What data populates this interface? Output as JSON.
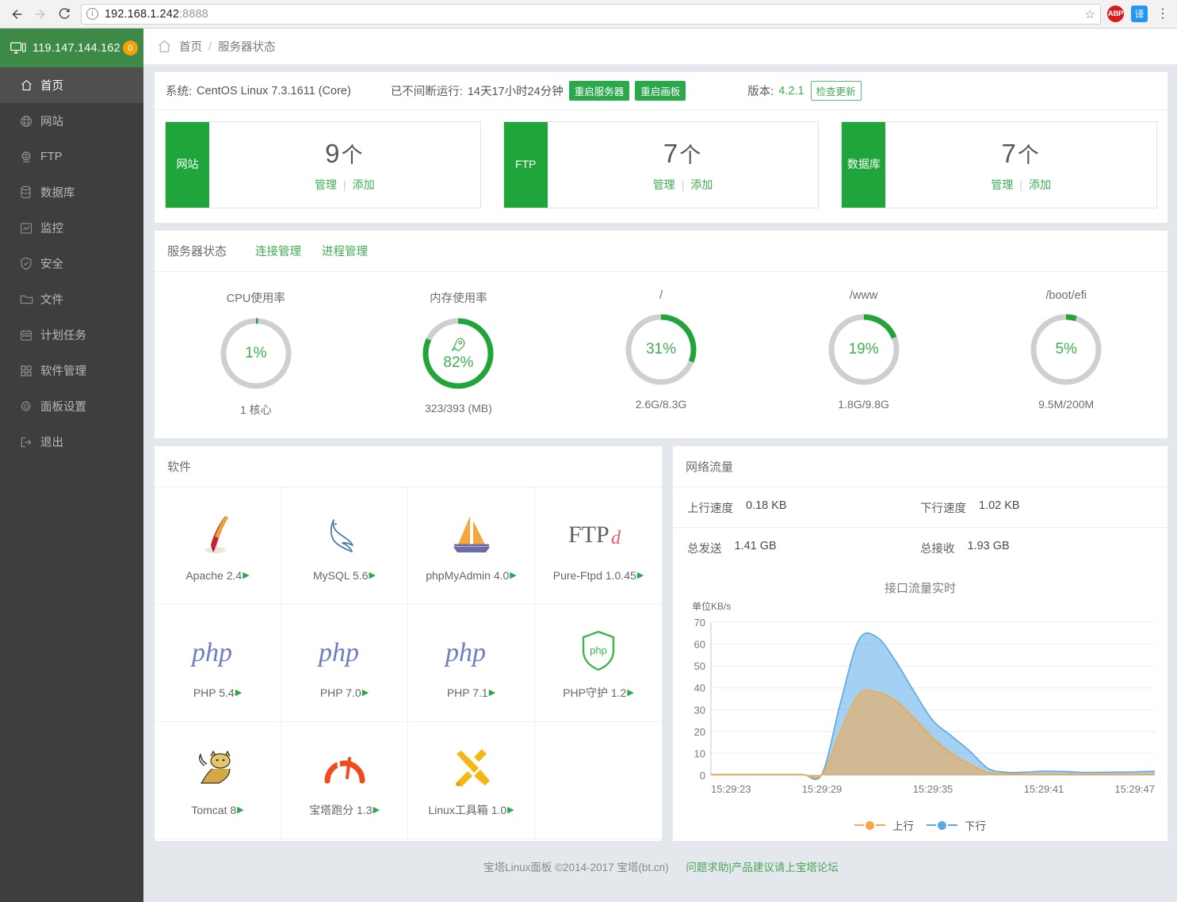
{
  "browser": {
    "back_icon": "back-arrow-icon",
    "forward_icon": "forward-arrow-icon",
    "reload_icon": "reload-icon",
    "url": "192.168.1.242",
    "url_port": ":8888",
    "bookmark_icon": "star-icon",
    "ext_abp_label": "ABP",
    "ext_translate_label": "译",
    "menu_icon": "kebab-menu-icon"
  },
  "sidebar": {
    "host": "119.147.144.162",
    "badge": "0",
    "items": [
      {
        "label": "首页",
        "icon": "home-icon"
      },
      {
        "label": "网站",
        "icon": "globe-icon"
      },
      {
        "label": "FTP",
        "icon": "ftp-icon"
      },
      {
        "label": "数据库",
        "icon": "database-icon"
      },
      {
        "label": "监控",
        "icon": "chart-monitor-icon"
      },
      {
        "label": "安全",
        "icon": "shield-icon"
      },
      {
        "label": "文件",
        "icon": "folder-icon"
      },
      {
        "label": "计划任务",
        "icon": "calendar-icon"
      },
      {
        "label": "软件管理",
        "icon": "grid-apps-icon"
      },
      {
        "label": "面板设置",
        "icon": "gear-icon"
      },
      {
        "label": "退出",
        "icon": "logout-icon"
      }
    ]
  },
  "breadcrumb": {
    "home_icon": "home-icon",
    "home": "首页",
    "separator": "/",
    "current": "服务器状态"
  },
  "system": {
    "os_label": "系统:",
    "os_value": "CentOS Linux 7.3.1611 (Core)",
    "uptime_label": "已不间断运行:",
    "uptime_value": "14天17小时24分钟",
    "restart_server": "重启服务器",
    "restart_panel": "重启画板",
    "version_label": "版本:",
    "version_value": "4.2.1",
    "check_update": "检查更新"
  },
  "stats": [
    {
      "side": "网站",
      "count": "9",
      "unit": "个",
      "manage": "管理",
      "add": "添加"
    },
    {
      "side": "FTP",
      "count": "7",
      "unit": "个",
      "manage": "管理",
      "add": "添加"
    },
    {
      "side": "数据库",
      "count": "7",
      "unit": "个",
      "manage": "管理",
      "add": "添加"
    }
  ],
  "server_status": {
    "title": "服务器状态",
    "tool_conn": "连接管理",
    "tool_proc": "进程管理",
    "gauges": [
      {
        "title": "CPU使用率",
        "percent": 1,
        "label": "1%",
        "sub": "1 核心",
        "icon": ""
      },
      {
        "title": "内存使用率",
        "percent": 82,
        "label": "82%",
        "sub": "323/393 (MB)",
        "icon": "rocket-icon"
      },
      {
        "title": "/",
        "percent": 31,
        "label": "31%",
        "sub": "2.6G/8.3G",
        "icon": ""
      },
      {
        "title": "/www",
        "percent": 19,
        "label": "19%",
        "sub": "1.8G/9.8G",
        "icon": ""
      },
      {
        "title": "/boot/efi",
        "percent": 5,
        "label": "5%",
        "sub": "9.5M/200M",
        "icon": ""
      }
    ]
  },
  "software": {
    "title": "软件",
    "items": [
      {
        "name": "Apache 2.4",
        "icon": "apache-feather-icon",
        "arrow": "▶"
      },
      {
        "name": "MySQL 5.6",
        "icon": "mysql-dolphin-icon",
        "arrow": "▶"
      },
      {
        "name": "phpMyAdmin 4.0",
        "icon": "phpmyadmin-sail-icon",
        "arrow": "▶"
      },
      {
        "name": "Pure-Ftpd 1.0.45",
        "icon": "pureftpd-icon",
        "arrow": "▶"
      },
      {
        "name": "PHP 5.4",
        "icon": "php-icon",
        "arrow": "▶"
      },
      {
        "name": "PHP 7.0",
        "icon": "php-icon",
        "arrow": "▶"
      },
      {
        "name": "PHP 7.1",
        "icon": "php-icon",
        "arrow": "▶"
      },
      {
        "name": "PHP守护 1.2",
        "icon": "php-shield-icon",
        "arrow": "▶"
      },
      {
        "name": "Tomcat 8",
        "icon": "tomcat-cat-icon",
        "arrow": "▶"
      },
      {
        "name": "宝塔跑分 1.3",
        "icon": "gauge-speed-icon",
        "arrow": "▶"
      },
      {
        "name": "Linux工具箱 1.0",
        "icon": "tools-wrench-icon",
        "arrow": "▶"
      }
    ]
  },
  "network": {
    "title": "网络流量",
    "up_speed_label": "上行速度",
    "up_speed_value": "0.18 KB",
    "down_speed_label": "下行速度",
    "down_speed_value": "1.02 KB",
    "total_sent_label": "总发送",
    "total_sent_value": "1.41 GB",
    "total_recv_label": "总接收",
    "total_recv_value": "1.93 GB",
    "colors": {
      "up": "#f5a846",
      "down": "#5aa9e6"
    }
  },
  "chart_data": {
    "type": "area",
    "title": "接口流量实时",
    "ylabel": "单位KB/s",
    "xlabel": "",
    "ylim": [
      0,
      70
    ],
    "yticks": [
      0,
      10,
      20,
      30,
      40,
      50,
      60,
      70
    ],
    "xticks": [
      "15:29:23",
      "15:29:29",
      "15:29:35",
      "15:29:41",
      "15:29:47"
    ],
    "grid": true,
    "legend_position": "bottom",
    "x": [
      "15:29:23",
      "15:29:24",
      "15:29:25",
      "15:29:26",
      "15:29:27",
      "15:29:28",
      "15:29:29",
      "15:29:30",
      "15:29:31",
      "15:29:32",
      "15:29:33",
      "15:29:34",
      "15:29:35",
      "15:29:36",
      "15:29:37",
      "15:29:38",
      "15:29:39",
      "15:29:40",
      "15:29:41",
      "15:29:42",
      "15:29:43",
      "15:29:44",
      "15:29:45",
      "15:29:46",
      "15:29:47"
    ],
    "series": [
      {
        "name": "上行",
        "color": "#f5a846",
        "values": [
          0.2,
          0.2,
          0.2,
          0.2,
          0.2,
          0.2,
          0.3,
          20,
          37,
          38,
          34,
          26,
          17,
          10,
          5,
          1.2,
          0.6,
          0.5,
          0.5,
          0.5,
          0.4,
          0.4,
          0.4,
          0.4,
          0.4
        ]
      },
      {
        "name": "下行",
        "color": "#5aa9e6",
        "values": [
          0.3,
          0.3,
          0.3,
          0.3,
          0.3,
          0.3,
          0.5,
          33,
          62,
          63,
          52,
          38,
          25,
          18,
          11,
          3,
          1.3,
          1.4,
          1.8,
          1.7,
          1.3,
          1.3,
          1.4,
          1.5,
          1.8
        ]
      }
    ]
  },
  "footer": {
    "copyright": "宝塔Linux面板 ©2014-2017 宝塔(bt.cn)",
    "link": "问题求助|产品建议请上宝塔论坛"
  }
}
